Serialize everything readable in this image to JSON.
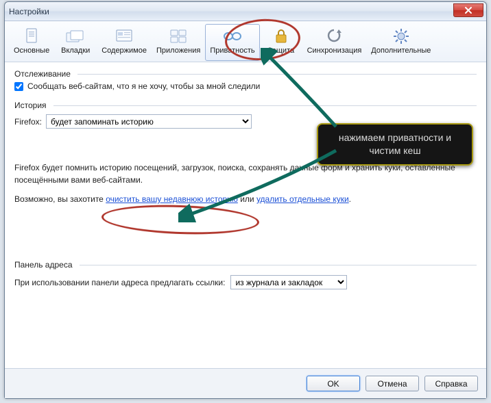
{
  "window": {
    "title": "Настройки"
  },
  "toolbar": {
    "items": [
      {
        "label": "Основные",
        "icon": "general"
      },
      {
        "label": "Вкладки",
        "icon": "tabs"
      },
      {
        "label": "Содержимое",
        "icon": "content"
      },
      {
        "label": "Приложения",
        "icon": "apps"
      },
      {
        "label": "Приватность",
        "icon": "privacy",
        "active": true
      },
      {
        "label": "Защита",
        "icon": "security"
      },
      {
        "label": "Синхронизация",
        "icon": "sync"
      },
      {
        "label": "Дополнительные",
        "icon": "advanced"
      }
    ]
  },
  "tracking": {
    "section_label": "Отслеживание",
    "checkbox_label": "Сообщать веб-сайтам, что я не хочу, чтобы за мной следили",
    "checked": true
  },
  "history": {
    "section_label": "История",
    "dropdown_prefix": "Firefox:",
    "dropdown_value": "будет запоминать историю",
    "desc_line1": "Firefox будет помнить историю посещений, загрузок, поиска, сохранять данные форм и хранить куки, оставленные посещёнными вами веб-сайтами.",
    "desc_maybe_prefix": "Возможно, вы захотите ",
    "link_clear": "очистить вашу недавнюю историю",
    "desc_or": " или ",
    "link_cookies": "удалить отдельные куки",
    "desc_period": "."
  },
  "address_panel": {
    "section_label": "Панель адреса",
    "prefix": "При использовании панели адреса предлагать ссылки:",
    "dropdown_value": "из журнала и закладок"
  },
  "footer": {
    "ok": "OK",
    "cancel": "Отмена",
    "help": "Справка"
  },
  "annotation": {
    "callout_text": "нажимаем приватности и чистим кеш"
  }
}
